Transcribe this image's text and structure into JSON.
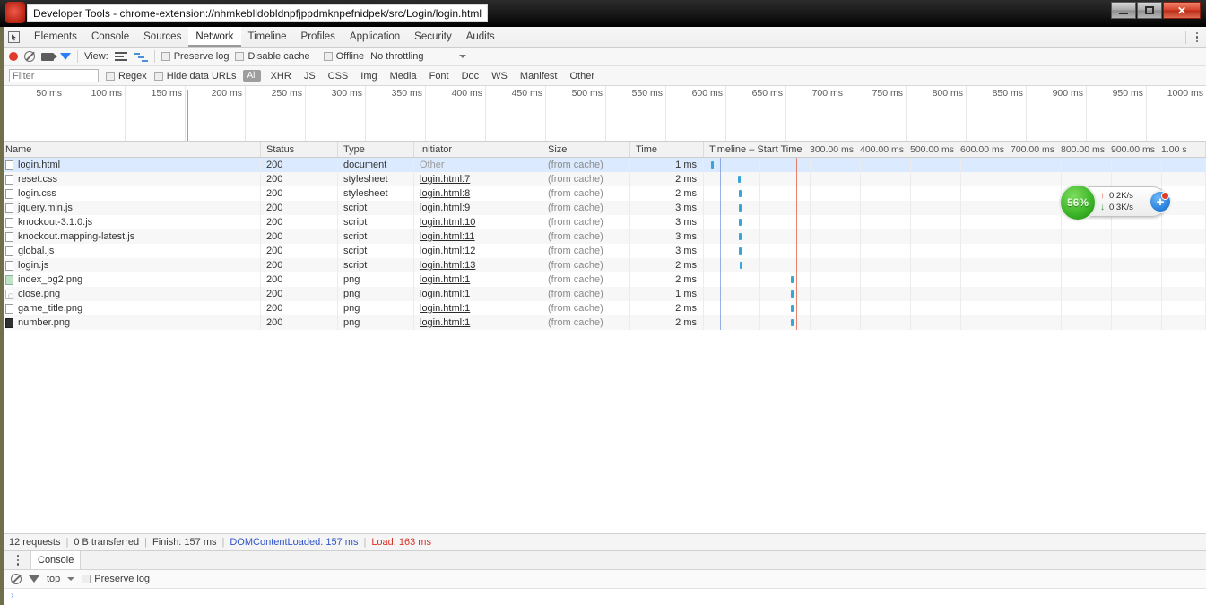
{
  "window": {
    "title": "Developer Tools - chrome-extension://nhmkeblldobldnpfjppdmknpefnidpek/src/Login/login.html",
    "minimize_label": "Minimize",
    "maximize_label": "Maximize",
    "close_label": "✕"
  },
  "tabs": {
    "inspect_icon": "inspect-element-icon",
    "items": [
      {
        "label": "Elements",
        "active": false
      },
      {
        "label": "Console",
        "active": false
      },
      {
        "label": "Sources",
        "active": false
      },
      {
        "label": "Network",
        "active": true
      },
      {
        "label": "Timeline",
        "active": false
      },
      {
        "label": "Profiles",
        "active": false
      },
      {
        "label": "Application",
        "active": false
      },
      {
        "label": "Security",
        "active": false
      },
      {
        "label": "Audits",
        "active": false
      }
    ],
    "menu_icon": "more-vertical-icon"
  },
  "toolbar": {
    "record_icon": "record-icon",
    "clear_icon": "clear-icon",
    "camera_icon": "camera-icon",
    "filter_icon": "filter-funnel-icon",
    "view_label": "View:",
    "view_list_icon": "list-view-icon",
    "view_waterfall_icon": "waterfall-view-icon",
    "preserve_log": "Preserve log",
    "disable_cache": "Disable cache",
    "offline": "Offline",
    "throttling": "No throttling",
    "throttling_caret": "chevron-down-icon"
  },
  "filterbar": {
    "placeholder": "Filter",
    "value": "",
    "regex": "Regex",
    "hide_data_urls": "Hide data URLs",
    "types": [
      "All",
      "XHR",
      "JS",
      "CSS",
      "Img",
      "Media",
      "Font",
      "Doc",
      "WS",
      "Manifest",
      "Other"
    ],
    "active_type": "All"
  },
  "overview": {
    "ticks": [
      "50 ms",
      "100 ms",
      "150 ms",
      "200 ms",
      "250 ms",
      "300 ms",
      "350 ms",
      "400 ms",
      "450 ms",
      "500 ms",
      "550 ms",
      "600 ms",
      "650 ms",
      "700 ms",
      "750 ms",
      "800 ms",
      "850 ms",
      "900 ms",
      "950 ms",
      "1000 ms"
    ],
    "dom_content_loaded_marker_ms": 157,
    "load_marker_ms": 163
  },
  "table": {
    "columns": [
      "Name",
      "Status",
      "Type",
      "Initiator",
      "Size",
      "Time",
      "Timeline – Start Time"
    ],
    "timeline_labels": [
      "300.00 ms",
      "400.00 ms",
      "500.00 ms",
      "600.00 ms",
      "700.00 ms",
      "800.00 ms",
      "900.00 ms",
      "1.00 s"
    ],
    "rows": [
      {
        "name": "login.html",
        "icon": "document-icon",
        "status": "200",
        "type": "document",
        "initiator": "Other",
        "initiator_link": false,
        "size": "(from cache)",
        "time": "1 ms",
        "bar_start_pct": 1.5,
        "bar_width_pct": 1.2,
        "selected": true
      },
      {
        "name": "reset.css",
        "icon": "document-icon",
        "status": "200",
        "type": "stylesheet",
        "initiator": "login.html:7",
        "initiator_link": true,
        "size": "(from cache)",
        "time": "2 ms",
        "bar_start_pct": 6.8,
        "bar_width_pct": 1.0,
        "selected": false
      },
      {
        "name": "login.css",
        "icon": "document-icon",
        "status": "200",
        "type": "stylesheet",
        "initiator": "login.html:8",
        "initiator_link": true,
        "size": "(from cache)",
        "time": "2 ms",
        "bar_start_pct": 6.9,
        "bar_width_pct": 1.0,
        "selected": false
      },
      {
        "name": "jquery.min.js",
        "icon": "document-icon",
        "status": "200",
        "type": "script",
        "initiator": "login.html:9",
        "initiator_link": true,
        "size": "(from cache)",
        "time": "3 ms",
        "bar_start_pct": 7.0,
        "bar_width_pct": 1.0,
        "selected": false
      },
      {
        "name": "knockout-3.1.0.js",
        "icon": "document-icon",
        "status": "200",
        "type": "script",
        "initiator": "login.html:10",
        "initiator_link": true,
        "size": "(from cache)",
        "time": "3 ms",
        "bar_start_pct": 6.9,
        "bar_width_pct": 1.1,
        "selected": false
      },
      {
        "name": "knockout.mapping-latest.js",
        "icon": "document-icon",
        "status": "200",
        "type": "script",
        "initiator": "login.html:11",
        "initiator_link": true,
        "size": "(from cache)",
        "time": "3 ms",
        "bar_start_pct": 7.0,
        "bar_width_pct": 1.1,
        "selected": false
      },
      {
        "name": "global.js",
        "icon": "document-icon",
        "status": "200",
        "type": "script",
        "initiator": "login.html:12",
        "initiator_link": true,
        "size": "(from cache)",
        "time": "3 ms",
        "bar_start_pct": 7.0,
        "bar_width_pct": 1.1,
        "selected": false
      },
      {
        "name": "login.js",
        "icon": "document-icon",
        "status": "200",
        "type": "script",
        "initiator": "login.html:13",
        "initiator_link": true,
        "size": "(from cache)",
        "time": "2 ms",
        "bar_start_pct": 7.1,
        "bar_width_pct": 1.1,
        "selected": false
      },
      {
        "name": "index_bg2.png",
        "icon": "image-green-icon",
        "status": "200",
        "type": "png",
        "initiator": "login.html:1",
        "initiator_link": true,
        "size": "(from cache)",
        "time": "2 ms",
        "bar_start_pct": 17.3,
        "bar_width_pct": 1.0,
        "selected": false
      },
      {
        "name": "close.png",
        "icon": "image-ring-icon",
        "status": "200",
        "type": "png",
        "initiator": "login.html:1",
        "initiator_link": true,
        "size": "(from cache)",
        "time": "1 ms",
        "bar_start_pct": 17.4,
        "bar_width_pct": 0.9,
        "selected": false
      },
      {
        "name": "game_title.png",
        "icon": "document-icon",
        "status": "200",
        "type": "png",
        "initiator": "login.html:1",
        "initiator_link": true,
        "size": "(from cache)",
        "time": "2 ms",
        "bar_start_pct": 17.4,
        "bar_width_pct": 1.0,
        "selected": false
      },
      {
        "name": "number.png",
        "icon": "image-dark-icon",
        "status": "200",
        "type": "png",
        "initiator": "login.html:1",
        "initiator_link": true,
        "size": "(from cache)",
        "time": "2 ms",
        "bar_start_pct": 17.4,
        "bar_width_pct": 1.0,
        "selected": false
      }
    ]
  },
  "speed_widget": {
    "percent": "56%",
    "upload": "0.2K/s",
    "download": "0.3K/s",
    "upload_icon": "arrow-up-icon",
    "download_icon": "arrow-down-icon",
    "add_label": "+",
    "accent_green": "#3fb82a",
    "accent_blue": "#2f86e0"
  },
  "statusbar": {
    "requests": "12 requests",
    "transferred": "0 B transferred",
    "finish": "Finish: 157 ms",
    "dom_content_loaded": "DOMContentLoaded: 157 ms",
    "load": "Load: 163 ms",
    "separator": "|",
    "dcl_color": "#2f54c8",
    "load_color": "#d93025"
  },
  "drawer": {
    "menu_icon": "more-vertical-icon",
    "tab_label": "Console",
    "clear_icon": "clear-icon",
    "filter_icon": "filter-funnel-icon",
    "context": "top",
    "context_caret": "chevron-down-icon",
    "preserve_log": "Preserve log",
    "prompt": "›"
  }
}
